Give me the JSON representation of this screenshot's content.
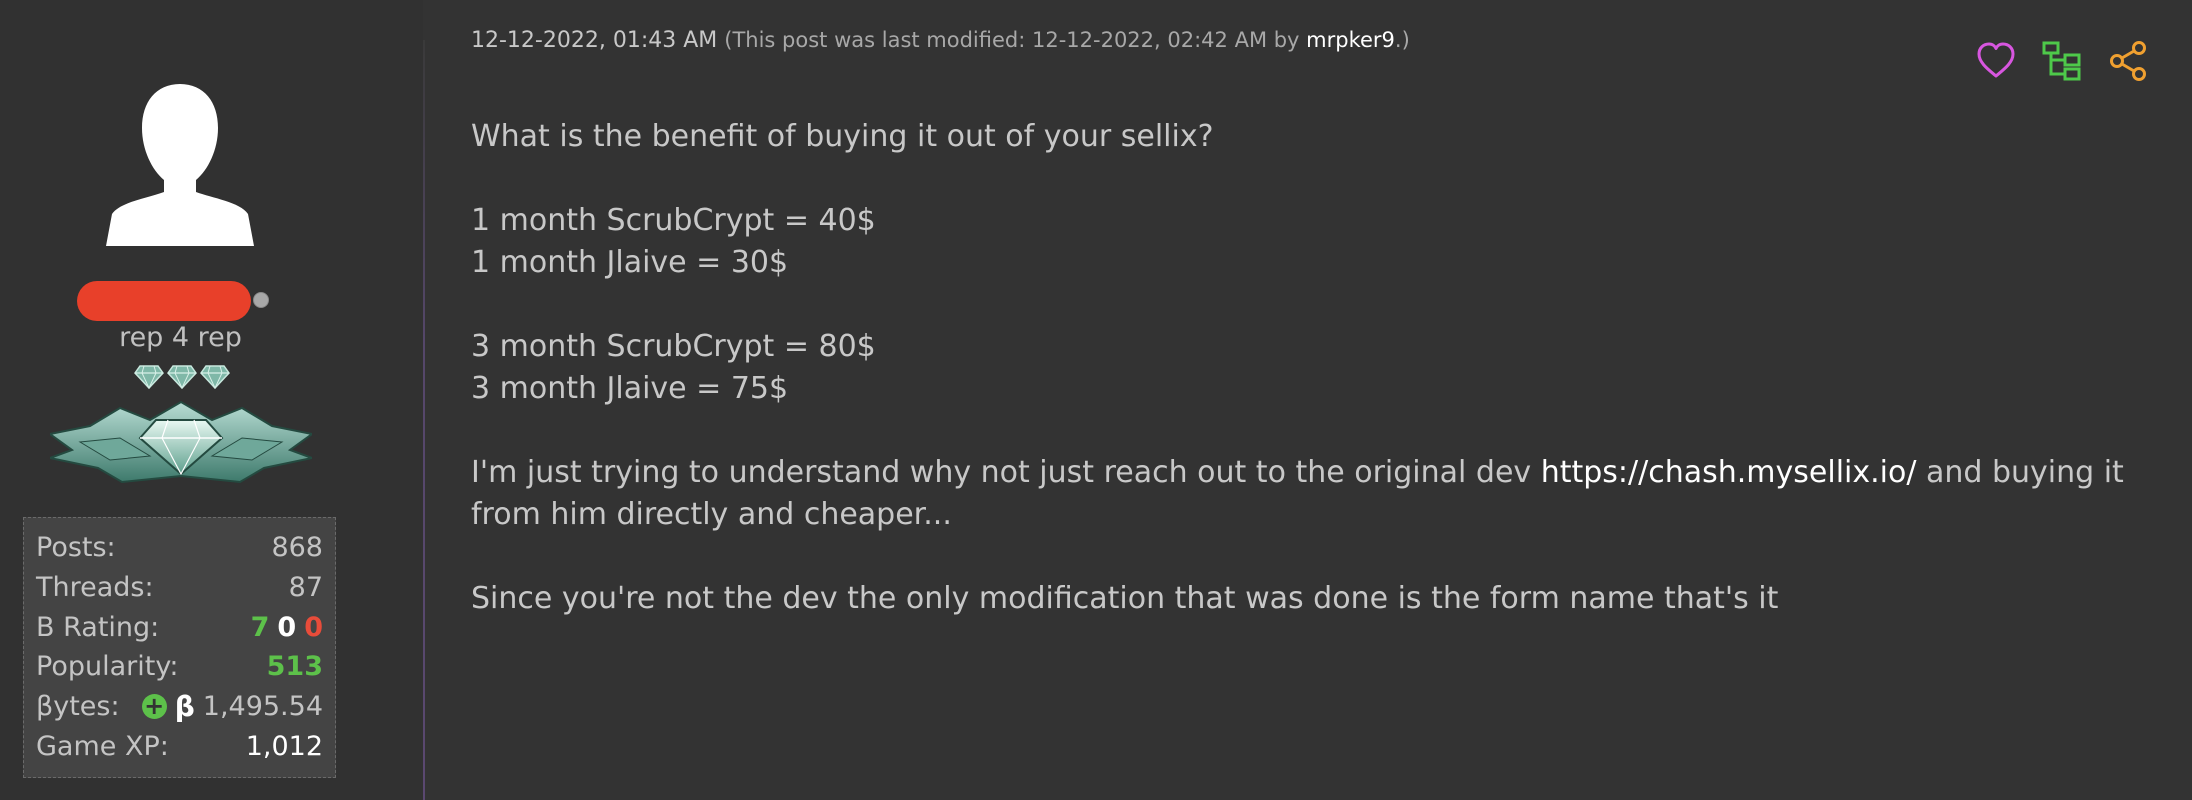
{
  "author": {
    "usertitle": "rep 4 rep",
    "stats": {
      "posts_label": "Posts:",
      "posts": "868",
      "threads_label": "Threads:",
      "threads": "87",
      "b_rating_label": "B Rating:",
      "b_rating_positive": "7",
      "b_rating_neutral": "0",
      "b_rating_negative": "0",
      "popularity_label": "Popularity:",
      "popularity": "513",
      "bytes_label": "βytes:",
      "bytes_plus": "+",
      "bytes_symbol": "β",
      "bytes": "1,495.54",
      "game_xp_label": "Game XP:",
      "game_xp": "1,012"
    }
  },
  "post": {
    "date": "12-12-2022, 01:43 AM",
    "modified_prefix": "(This post was last modified: 12-12-2022, 02:42 AM by ",
    "modified_by": "mrpker9",
    "modified_suffix": ".)",
    "line1": "What is the benefit of buying it out of your sellix?",
    "line2": "1 month ScrubCrypt = 40$",
    "line3": "1 month Jlaive = 30$",
    "line4": "3 month ScrubCrypt = 80$",
    "line5": "3 month Jlaive = 75$",
    "line6_before": "I'm just trying to understand why not just reach out to the original dev ",
    "line6_link": "https://chash.mysellix.io/",
    "line6_after": " and buying it from him directly and cheaper...",
    "line7": "Since you're not the dev the only modification that was done is the form name that's it"
  },
  "icons": {
    "like": "heart-icon",
    "thread_tree": "tree-icon",
    "share": "share-icon"
  },
  "colors": {
    "background": "#333333",
    "username_bar": "#e8402a",
    "green": "#5dc14a",
    "red": "#e84c3a",
    "like_icon": "#d856e0",
    "tree_icon": "#4ec94a",
    "share_icon": "#f0a030"
  }
}
